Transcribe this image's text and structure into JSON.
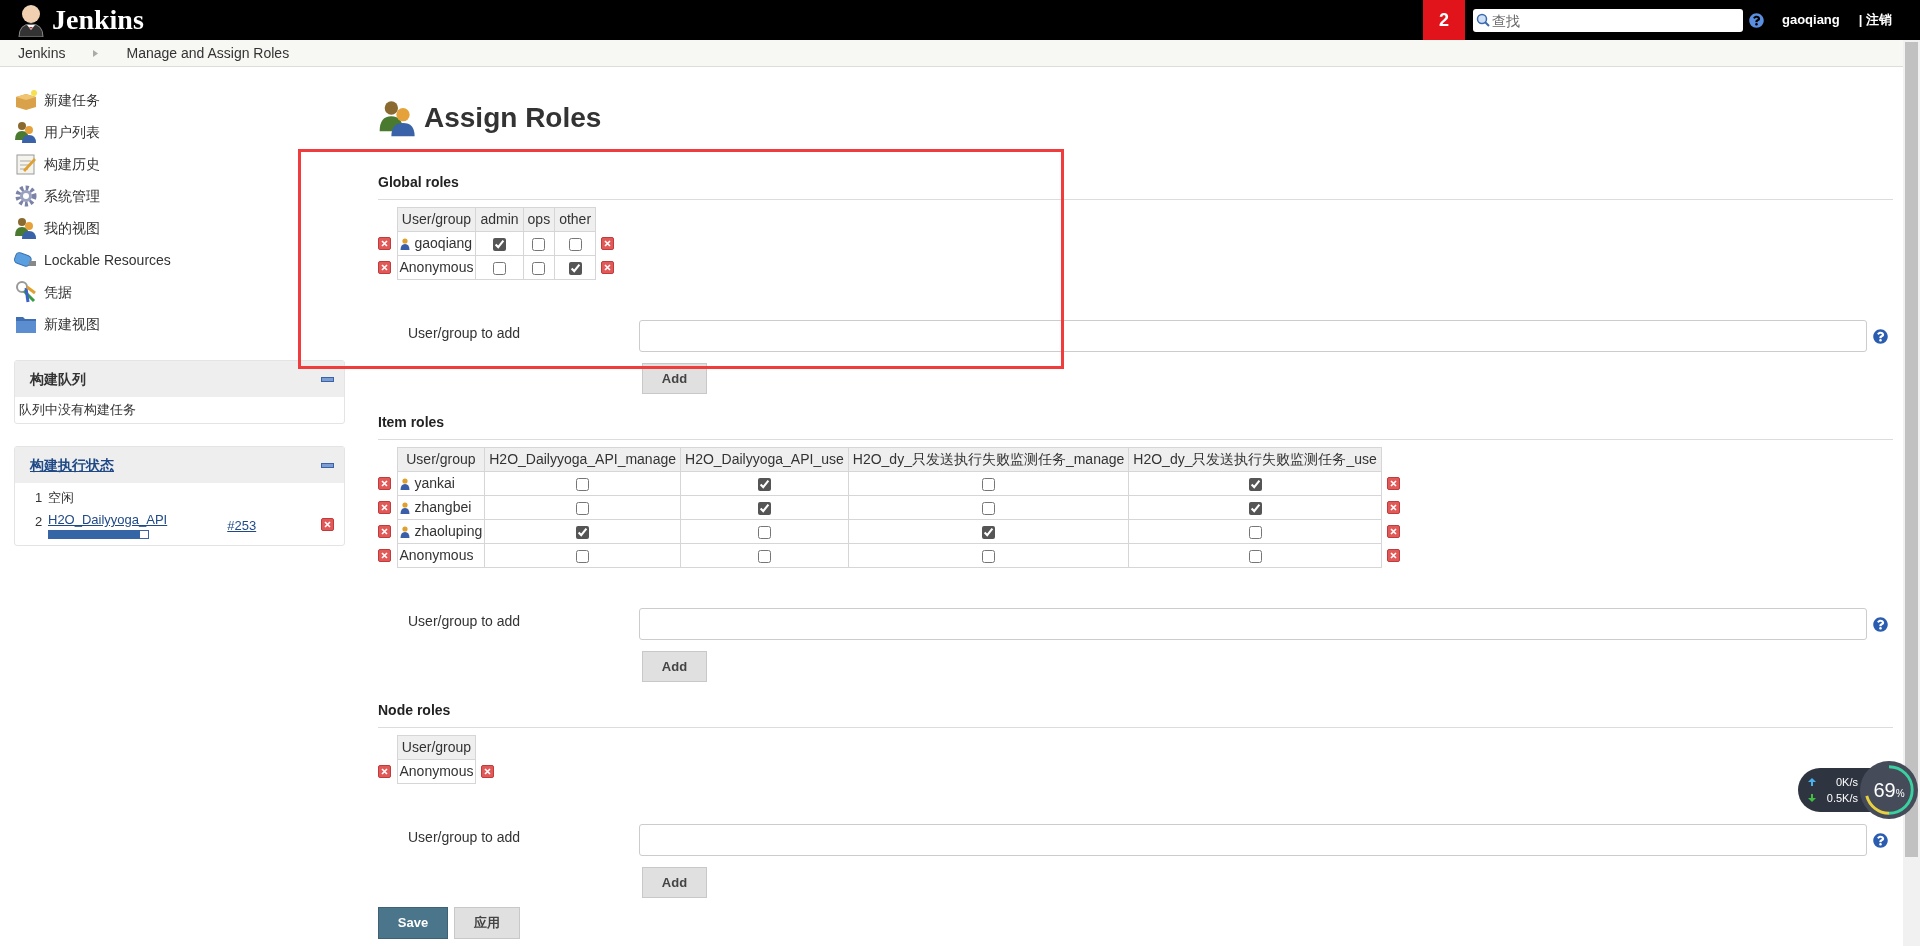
{
  "header": {
    "logo_text": "Jenkins",
    "badge": "2",
    "search": {
      "placeholder": "查找"
    },
    "user": "gaoqiang",
    "logout": "| 注销"
  },
  "breadcrumbs": [
    "Jenkins",
    "Manage and Assign Roles"
  ],
  "sidebar": {
    "items": [
      "新建任务",
      "用户列表",
      "构建历史",
      "系统管理",
      "我的视图",
      "Lockable Resources",
      "凭据",
      "新建视图"
    ]
  },
  "build_queue": {
    "title": "构建队列",
    "empty_text": "队列中没有构建任务"
  },
  "executors": {
    "title": "构建执行状态",
    "rows": [
      {
        "number": "1",
        "status": "空闲"
      },
      {
        "number": "2",
        "job": "H2O_Dailyyoga_API",
        "build": "#253",
        "level": 0.92
      }
    ]
  },
  "page_title": "Assign Roles",
  "sections": [
    {
      "title": "Global roles",
      "columns": [
        "User/group",
        "admin",
        "ops",
        "other"
      ],
      "rows": [
        {
          "name": "gaoqiang",
          "kind": "user",
          "cells": [
            {
              "checked": true
            },
            {
              "checked": false
            },
            {
              "checked": false
            }
          ]
        },
        {
          "name": "Anonymous",
          "kind": "group",
          "cells": [
            {
              "checked": false
            },
            {
              "checked": false
            },
            {
              "checked": true
            }
          ]
        }
      ],
      "add_label": "User/group to add",
      "add_button": "Add"
    },
    {
      "title": "Item roles",
      "columns": [
        "User/group",
        "H2O_Dailyyoga_API_manage",
        "H2O_Dailyyoga_API_use",
        "H2O_dy_只发送执行失败监测任务_manage",
        "H2O_dy_只发送执行失败监测任务_use"
      ],
      "rows": [
        {
          "name": "yankai",
          "kind": "user",
          "cells": [
            {
              "checked": false
            },
            {
              "checked": true
            },
            {
              "checked": false
            },
            {
              "checked": true
            }
          ]
        },
        {
          "name": "zhangbei",
          "kind": "user",
          "cells": [
            {
              "checked": false
            },
            {
              "checked": true
            },
            {
              "checked": false
            },
            {
              "checked": true
            }
          ]
        },
        {
          "name": "zhaoluping",
          "kind": "user",
          "cells": [
            {
              "checked": true
            },
            {
              "checked": false
            },
            {
              "checked": true
            },
            {
              "checked": false
            }
          ]
        },
        {
          "name": "Anonymous",
          "kind": "group",
          "cells": [
            {
              "checked": false
            },
            {
              "checked": false
            },
            {
              "checked": false
            },
            {
              "checked": false
            }
          ]
        }
      ],
      "add_label": "User/group to add",
      "add_button": "Add"
    },
    {
      "title": "Node roles",
      "columns": [
        "User/group"
      ],
      "rows": [
        {
          "name": "Anonymous",
          "kind": "group",
          "cells": []
        }
      ],
      "add_label": "User/group to add",
      "add_button": "Add"
    }
  ],
  "buttons": [
    {
      "label": "Save",
      "kind": "primary"
    },
    {
      "label": "应用",
      "kind": "secondary"
    }
  ],
  "net_widget": {
    "upload": "0K/s",
    "download": "0.5K/s",
    "load": "69",
    "unit": "%"
  },
  "annotations": [
    {
      "kind": "rectangle"
    }
  ]
}
